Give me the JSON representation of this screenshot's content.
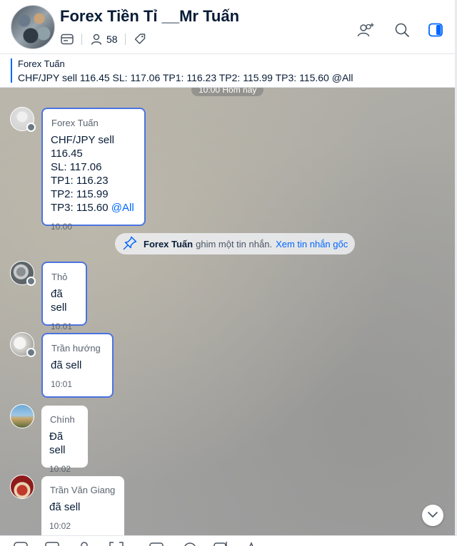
{
  "header": {
    "title": "Forex Tiền Tỉ __Mr Tuấn",
    "member_count": "58",
    "icons": [
      "card-icon",
      "members-icon",
      "tag-icon",
      "add-member-icon",
      "search-icon",
      "panel-toggle-icon"
    ]
  },
  "pinned": {
    "sender": "Forex Tuấn",
    "text": "CHF/JPY sell 116.45 SL: 117.06 TP1: 116.23 TP2: 115.99 TP3: 115.60 @All"
  },
  "chat": {
    "date_separator": "10:00 Hôm nay",
    "messages": [
      {
        "sender": "Forex Tuấn",
        "lines": [
          "CHF/JPY sell 116.45",
          "SL: 117.06",
          "TP1: 116.23",
          "TP2: 115.99"
        ],
        "last_line": "TP3: 115.60",
        "mention": "@All",
        "time": "10:00"
      },
      {
        "sender": "Thỏ",
        "text": "đã sell",
        "time": "10:01"
      },
      {
        "sender": "Trần hướng",
        "text": "đã sell",
        "time": "10:01"
      },
      {
        "sender": "Chính",
        "text": "Đã sell",
        "time": "10:02"
      },
      {
        "sender": "Trần Văn Giang",
        "text": "đã sell",
        "time": "10:02"
      }
    ],
    "system": {
      "who": "Forex Tuấn",
      "action": "ghim một tin nhắn.",
      "link": "Xem tin nhắn gốc"
    }
  },
  "colors": {
    "accent": "#0068ff",
    "selected_border": "#4b73e0",
    "text_primary": "#081c36"
  }
}
